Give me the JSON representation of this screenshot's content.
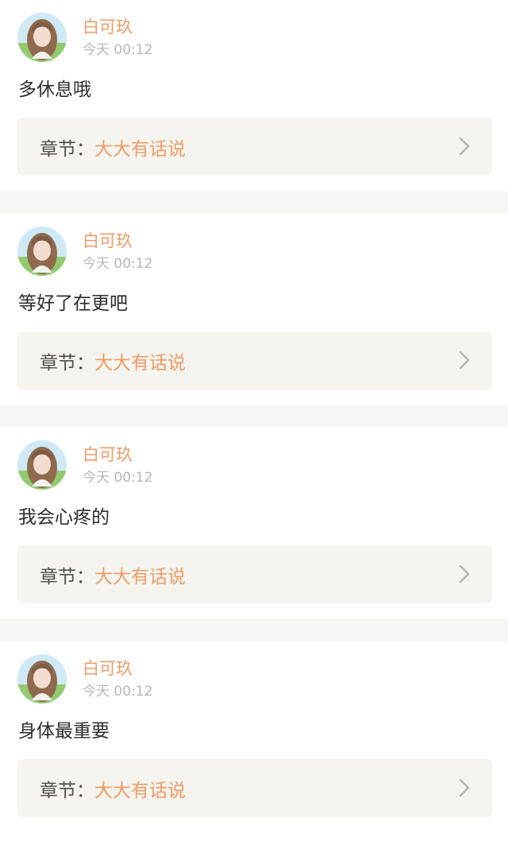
{
  "comments": [
    {
      "username": "白可玖",
      "time": "今天 00:12",
      "text": "多休息哦",
      "chapter_label": "章节：",
      "chapter_title": "大大有话说"
    },
    {
      "username": "白可玖",
      "time": "今天 00:12",
      "text": "等好了在更吧",
      "chapter_label": "章节：",
      "chapter_title": "大大有话说"
    },
    {
      "username": "白可玖",
      "time": "今天 00:12",
      "text": "我会心疼的",
      "chapter_label": "章节：",
      "chapter_title": "大大有话说"
    },
    {
      "username": "白可玖",
      "time": "今天 00:12",
      "text": "身体最重要",
      "chapter_label": "章节：",
      "chapter_title": "大大有话说"
    }
  ],
  "icons": {
    "avatar": "user-avatar",
    "chevron": "chevron-right-icon"
  },
  "colors": {
    "accent": "#ef9b67",
    "card_bg": "#f5f4ee",
    "divider": "#f6f6f4"
  }
}
